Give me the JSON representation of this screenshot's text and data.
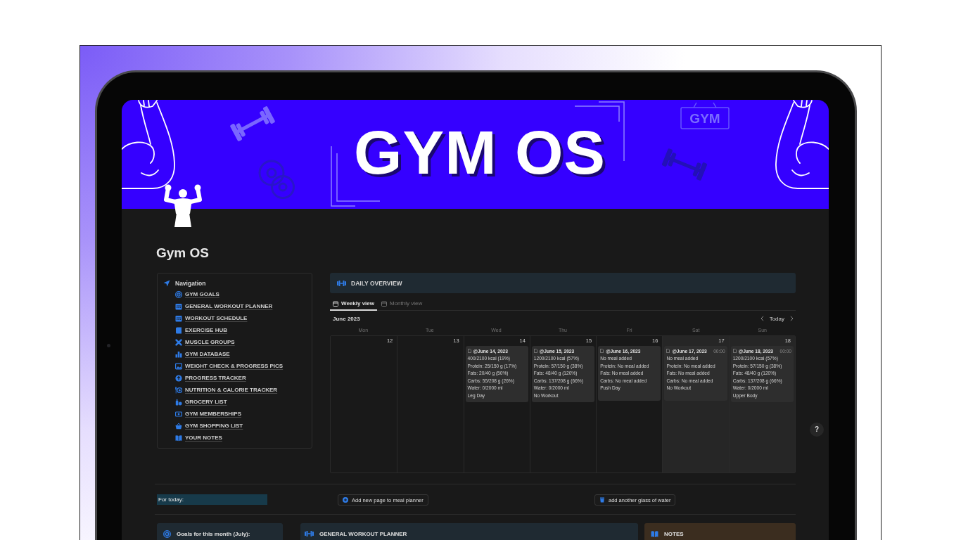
{
  "banner": {
    "title": "GYM OS",
    "sign": "GYM"
  },
  "page": {
    "title": "Gym OS"
  },
  "navigation": {
    "heading": "Navigation",
    "items": [
      {
        "label": "GYM GOALS"
      },
      {
        "label": "GENERAL WORKOUT PLANNER"
      },
      {
        "label": "WORKOUT SCHEDULE"
      },
      {
        "label": "EXERCISE HUB"
      },
      {
        "label": "MUSCLE GROUPS"
      },
      {
        "label": "GYM DATABASE"
      },
      {
        "label": "WEIGHT CHECK & PROGRESS PICS"
      },
      {
        "label": "PROGRESS TRACKER"
      },
      {
        "label": "NUTRITION & CALORIE TRACKER"
      },
      {
        "label": "GROCERY LIST"
      },
      {
        "label": "GYM MEMBERSHIPS"
      },
      {
        "label": "GYM SHOPPING LIST"
      },
      {
        "label": "YOUR NOTES"
      }
    ]
  },
  "daily_overview": {
    "heading": "DAILY OVERVIEW",
    "tabs": [
      {
        "label": "Weekly view",
        "selected": true
      },
      {
        "label": "Monthly view",
        "selected": false
      }
    ],
    "month": "June 2023",
    "today_button": "Today",
    "weekdays": [
      "Mon",
      "Tue",
      "Wed",
      "Thu",
      "Fri",
      "Sat",
      "Sun"
    ],
    "days": [
      {
        "number": "12",
        "weekend": false
      },
      {
        "number": "13",
        "weekend": false
      },
      {
        "number": "14",
        "weekend": false,
        "entry": {
          "date": "@June 14, 2023",
          "lines": [
            "400/2100 kcal (19%)",
            "Protein: 25/150 g (17%)",
            "Fats: 20/40 g (50%)",
            "Carbs: 55/208 g (26%)",
            "Water: 0/2000 ml",
            "Leg Day"
          ]
        }
      },
      {
        "number": "15",
        "weekend": false,
        "entry": {
          "date": "@June 15, 2023",
          "lines": [
            "1200/2100 kcal (57%)",
            "Protein: 57/150 g (38%)",
            "Fats: 48/40 g (120%)",
            "Carbs: 137/208 g (66%)",
            "Water: 0/2000 ml",
            "No Workout"
          ]
        }
      },
      {
        "number": "16",
        "weekend": false,
        "entry": {
          "date": "@June 16, 2023",
          "lines": [
            "No meal added",
            "Protein: No meal added",
            "Fats: No meal added",
            "Carbs: No meal added",
            "Push Day"
          ]
        }
      },
      {
        "number": "17",
        "weekend": true,
        "entry": {
          "date": "@June 17, 2023",
          "time": "00:00",
          "lines": [
            "No meal added",
            "Protein: No meal added",
            "Fats: No meal added",
            "Carbs: No meal added",
            "No Workout"
          ]
        }
      },
      {
        "number": "18",
        "weekend": true,
        "entry": {
          "date": "@June 18, 2023",
          "time": "00:00",
          "lines": [
            "1200/2100 kcal (57%)",
            "Protein: 57/150 g (38%)",
            "Fats: 48/40 g (120%)",
            "Carbs: 137/208 g (66%)",
            "Water: 0/2000 ml",
            "Upper Body"
          ]
        }
      }
    ]
  },
  "for_today": {
    "label": "For today:",
    "buttons": [
      {
        "label": "Add new page to meal planner"
      },
      {
        "label": "add another glass of water"
      }
    ]
  },
  "sections": [
    {
      "kind": "callout",
      "title": "Goals for this month (July):"
    },
    {
      "kind": "heading",
      "title": "GENERAL WORKOUT PLANNER"
    },
    {
      "kind": "notes",
      "title": "NOTES"
    }
  ],
  "help_button": "?"
}
